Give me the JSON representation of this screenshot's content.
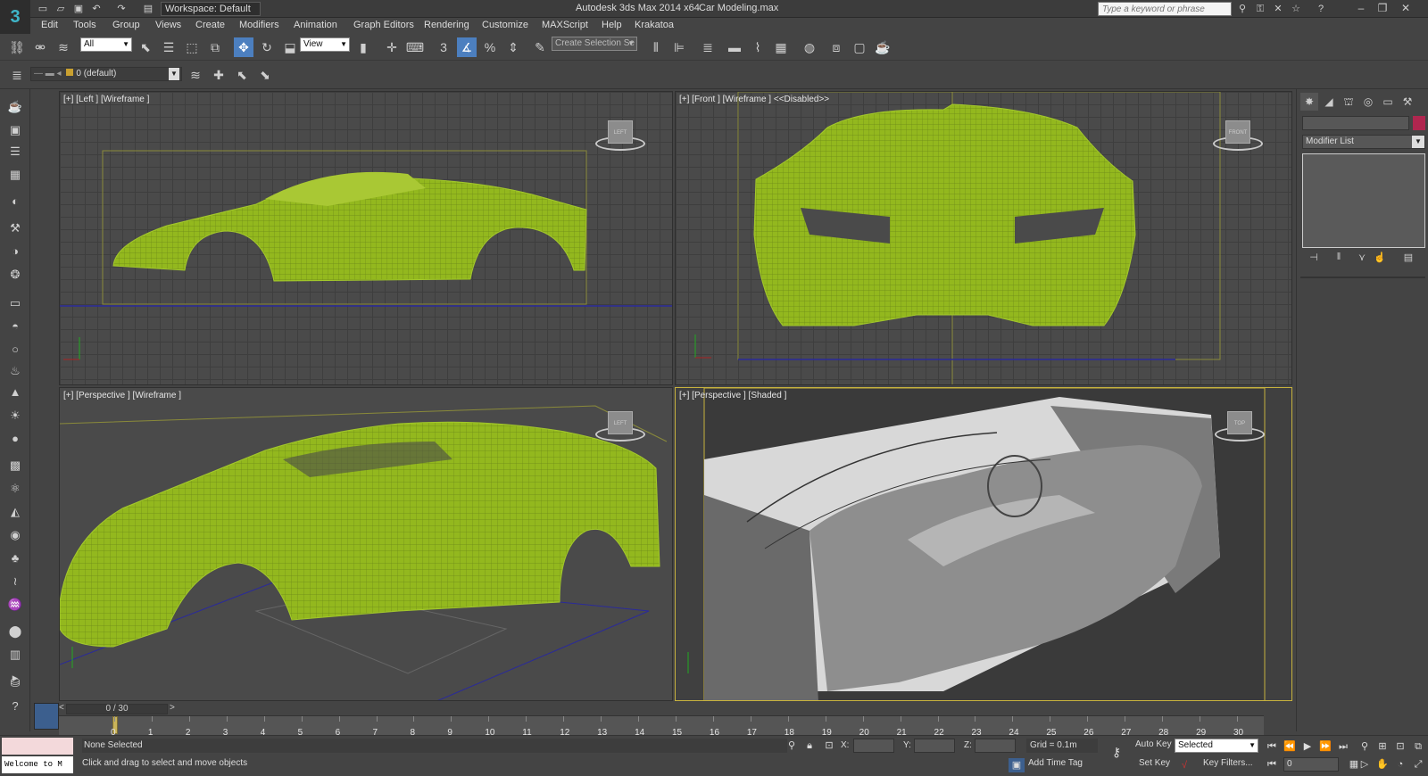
{
  "titlebar": {
    "logo": "3",
    "workspace": "Workspace: Default",
    "app_title": "Autodesk 3ds Max  2014 x64",
    "file_title": "Car Modeling.max",
    "search_placeholder": "Type a keyword or phrase"
  },
  "menu": [
    "Edit",
    "Tools",
    "Group",
    "Views",
    "Create",
    "Modifiers",
    "Animation",
    "Graph Editors",
    "Rendering",
    "Customize",
    "MAXScript",
    "Help",
    "Krakatoa"
  ],
  "toolbar": {
    "selection_filter": "All",
    "ref_coord": "View",
    "named_selection_placeholder": "Create Selection Se",
    "snap_label": "3",
    "percent_snap": "%"
  },
  "layer_toolbar": {
    "layer": "0 (default)"
  },
  "viewports": {
    "top_left": {
      "label": "[+] [Left ] [Wireframe ]",
      "cube": "LEFT"
    },
    "top_right": {
      "label": "[+] [Front ] [Wireframe ]  <<Disabled>>",
      "cube": "FRONT"
    },
    "bottom_left": {
      "label": "[+] [Perspective ] [Wireframe ]",
      "cube": "LEFT"
    },
    "bottom_right": {
      "label": "[+] [Perspective ] [Shaded ]",
      "cube": "TOP"
    }
  },
  "colors": {
    "wire": "#9fbf2a",
    "active_border": "#c7b23e",
    "viewport_bg": "#4a4a4a"
  },
  "command_panel": {
    "modifier_list": "Modifier List"
  },
  "timeline": {
    "slider": "0 / 30",
    "ticks": [
      "0",
      "1",
      "2",
      "3",
      "4",
      "5",
      "6",
      "7",
      "8",
      "9",
      "10",
      "11",
      "12",
      "13",
      "14",
      "15",
      "16",
      "17",
      "18",
      "19",
      "20",
      "21",
      "22",
      "23",
      "24",
      "25",
      "26",
      "27",
      "28",
      "29",
      "30"
    ]
  },
  "status": {
    "maxscript_listener": "Welcome to M",
    "selection": "None Selected",
    "prompt": "Click and drag to select and move objects",
    "x_label": "X:",
    "y_label": "Y:",
    "z_label": "Z:",
    "grid": "Grid = 0.1m",
    "add_time_tag": "Add Time Tag",
    "auto_key": "Auto Key",
    "set_key": "Set Key",
    "selected": "Selected",
    "key_filters": "Key Filters...",
    "current_frame": "0"
  }
}
